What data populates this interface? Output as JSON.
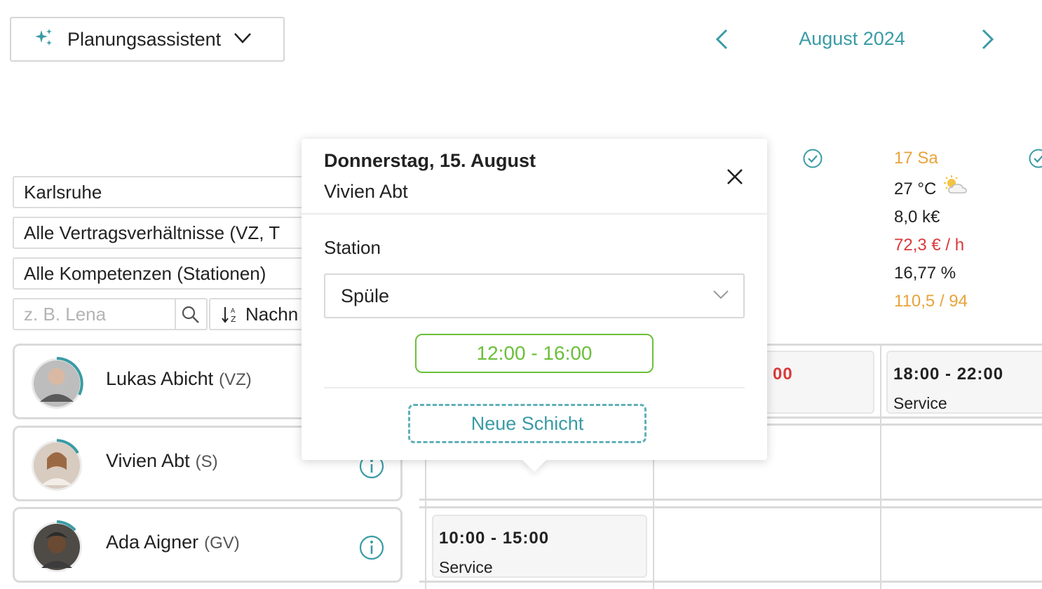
{
  "toolbar": {
    "assistant_label": "Planungsassistent",
    "month_title": "August 2024"
  },
  "filters": {
    "location": "Karlsruhe",
    "contracts": "Alle Vertragsverhältnisse (VZ, T",
    "competences": "Alle Kompetenzen (Stationen)",
    "search_placeholder": "z. B. Lena",
    "sort_label": "Nachn"
  },
  "day_header": {
    "label": "17 Sa",
    "temperature": "27 °C",
    "revenue": "8,0 k€",
    "rate": "72,3 € / h",
    "percent": "16,77 %",
    "hours": "110,5 / 94"
  },
  "employees": [
    {
      "name": "Lukas Abicht",
      "contract": "(VZ)"
    },
    {
      "name": "Vivien Abt",
      "contract": "(S)"
    },
    {
      "name": "Ada Aigner",
      "contract": "(GV)"
    }
  ],
  "shifts": {
    "partial_time": "00",
    "lukas_sat": {
      "time": "18:00 - 22:00",
      "type": "Service"
    },
    "ada_thu": {
      "time": "10:00 - 15:00",
      "type": "Service"
    }
  },
  "popover": {
    "date": "Donnerstag, 15. August",
    "employee": "Vivien Abt",
    "station_label": "Station",
    "station_value": "Spüle",
    "shift_time": "12:00 - 16:00",
    "new_shift_label": "Neue Schicht"
  },
  "colors": {
    "accent": "#3a9ba5",
    "positive": "#6bbf3a",
    "negative": "#d93a3a",
    "warning": "#e9a33a"
  }
}
